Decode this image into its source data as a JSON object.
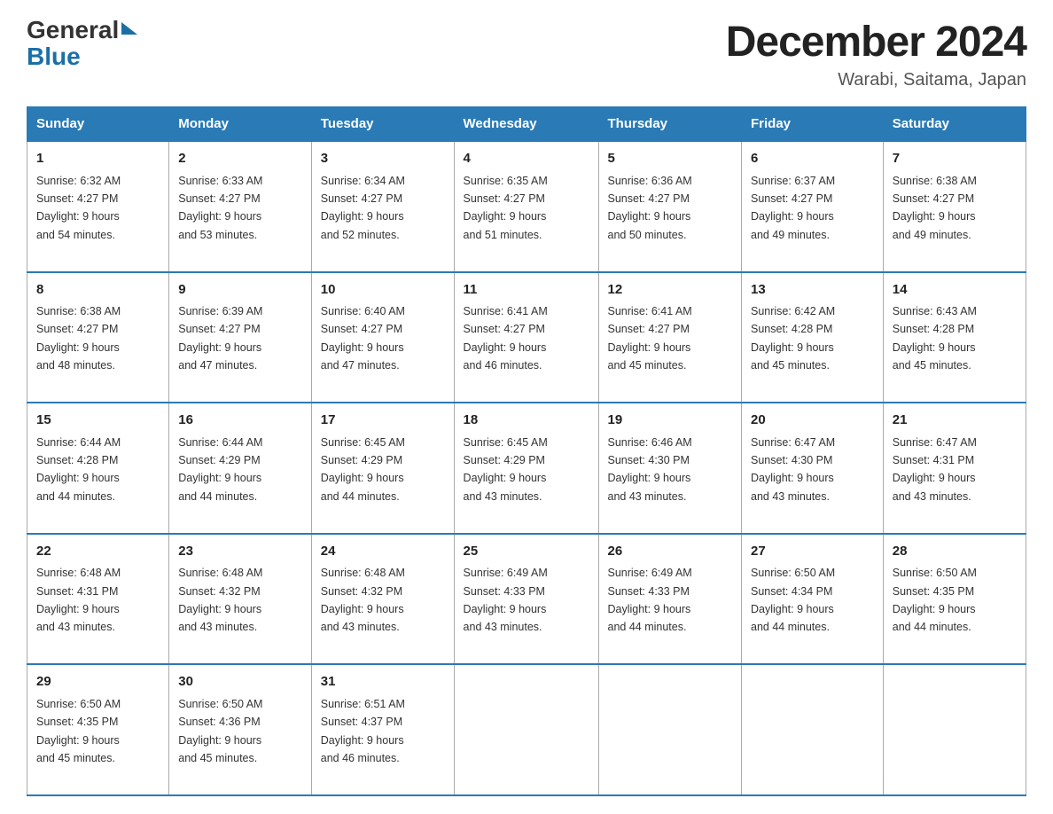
{
  "header": {
    "logo_general": "General",
    "logo_blue": "Blue",
    "month_title": "December 2024",
    "location": "Warabi, Saitama, Japan"
  },
  "days_of_week": [
    "Sunday",
    "Monday",
    "Tuesday",
    "Wednesday",
    "Thursday",
    "Friday",
    "Saturday"
  ],
  "weeks": [
    [
      {
        "day": "1",
        "sunrise": "6:32 AM",
        "sunset": "4:27 PM",
        "daylight": "9 hours and 54 minutes."
      },
      {
        "day": "2",
        "sunrise": "6:33 AM",
        "sunset": "4:27 PM",
        "daylight": "9 hours and 53 minutes."
      },
      {
        "day": "3",
        "sunrise": "6:34 AM",
        "sunset": "4:27 PM",
        "daylight": "9 hours and 52 minutes."
      },
      {
        "day": "4",
        "sunrise": "6:35 AM",
        "sunset": "4:27 PM",
        "daylight": "9 hours and 51 minutes."
      },
      {
        "day": "5",
        "sunrise": "6:36 AM",
        "sunset": "4:27 PM",
        "daylight": "9 hours and 50 minutes."
      },
      {
        "day": "6",
        "sunrise": "6:37 AM",
        "sunset": "4:27 PM",
        "daylight": "9 hours and 49 minutes."
      },
      {
        "day": "7",
        "sunrise": "6:38 AM",
        "sunset": "4:27 PM",
        "daylight": "9 hours and 49 minutes."
      }
    ],
    [
      {
        "day": "8",
        "sunrise": "6:38 AM",
        "sunset": "4:27 PM",
        "daylight": "9 hours and 48 minutes."
      },
      {
        "day": "9",
        "sunrise": "6:39 AM",
        "sunset": "4:27 PM",
        "daylight": "9 hours and 47 minutes."
      },
      {
        "day": "10",
        "sunrise": "6:40 AM",
        "sunset": "4:27 PM",
        "daylight": "9 hours and 47 minutes."
      },
      {
        "day": "11",
        "sunrise": "6:41 AM",
        "sunset": "4:27 PM",
        "daylight": "9 hours and 46 minutes."
      },
      {
        "day": "12",
        "sunrise": "6:41 AM",
        "sunset": "4:27 PM",
        "daylight": "9 hours and 45 minutes."
      },
      {
        "day": "13",
        "sunrise": "6:42 AM",
        "sunset": "4:28 PM",
        "daylight": "9 hours and 45 minutes."
      },
      {
        "day": "14",
        "sunrise": "6:43 AM",
        "sunset": "4:28 PM",
        "daylight": "9 hours and 45 minutes."
      }
    ],
    [
      {
        "day": "15",
        "sunrise": "6:44 AM",
        "sunset": "4:28 PM",
        "daylight": "9 hours and 44 minutes."
      },
      {
        "day": "16",
        "sunrise": "6:44 AM",
        "sunset": "4:29 PM",
        "daylight": "9 hours and 44 minutes."
      },
      {
        "day": "17",
        "sunrise": "6:45 AM",
        "sunset": "4:29 PM",
        "daylight": "9 hours and 44 minutes."
      },
      {
        "day": "18",
        "sunrise": "6:45 AM",
        "sunset": "4:29 PM",
        "daylight": "9 hours and 43 minutes."
      },
      {
        "day": "19",
        "sunrise": "6:46 AM",
        "sunset": "4:30 PM",
        "daylight": "9 hours and 43 minutes."
      },
      {
        "day": "20",
        "sunrise": "6:47 AM",
        "sunset": "4:30 PM",
        "daylight": "9 hours and 43 minutes."
      },
      {
        "day": "21",
        "sunrise": "6:47 AM",
        "sunset": "4:31 PM",
        "daylight": "9 hours and 43 minutes."
      }
    ],
    [
      {
        "day": "22",
        "sunrise": "6:48 AM",
        "sunset": "4:31 PM",
        "daylight": "9 hours and 43 minutes."
      },
      {
        "day": "23",
        "sunrise": "6:48 AM",
        "sunset": "4:32 PM",
        "daylight": "9 hours and 43 minutes."
      },
      {
        "day": "24",
        "sunrise": "6:48 AM",
        "sunset": "4:32 PM",
        "daylight": "9 hours and 43 minutes."
      },
      {
        "day": "25",
        "sunrise": "6:49 AM",
        "sunset": "4:33 PM",
        "daylight": "9 hours and 43 minutes."
      },
      {
        "day": "26",
        "sunrise": "6:49 AM",
        "sunset": "4:33 PM",
        "daylight": "9 hours and 44 minutes."
      },
      {
        "day": "27",
        "sunrise": "6:50 AM",
        "sunset": "4:34 PM",
        "daylight": "9 hours and 44 minutes."
      },
      {
        "day": "28",
        "sunrise": "6:50 AM",
        "sunset": "4:35 PM",
        "daylight": "9 hours and 44 minutes."
      }
    ],
    [
      {
        "day": "29",
        "sunrise": "6:50 AM",
        "sunset": "4:35 PM",
        "daylight": "9 hours and 45 minutes."
      },
      {
        "day": "30",
        "sunrise": "6:50 AM",
        "sunset": "4:36 PM",
        "daylight": "9 hours and 45 minutes."
      },
      {
        "day": "31",
        "sunrise": "6:51 AM",
        "sunset": "4:37 PM",
        "daylight": "9 hours and 46 minutes."
      },
      null,
      null,
      null,
      null
    ]
  ],
  "labels": {
    "sunrise": "Sunrise:",
    "sunset": "Sunset:",
    "daylight": "Daylight:"
  }
}
